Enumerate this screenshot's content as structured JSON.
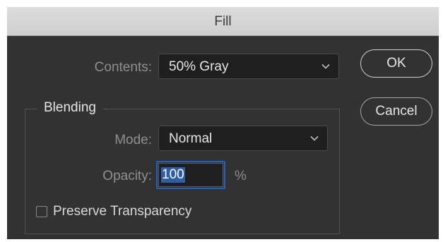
{
  "dialog": {
    "title": "Fill"
  },
  "contents": {
    "label": "Contents:",
    "value": "50% Gray",
    "chevron_icon": "chevron-down-icon"
  },
  "buttons": {
    "ok_label": "OK",
    "cancel_label": "Cancel"
  },
  "blending": {
    "group_label": "Blending",
    "mode_label": "Mode:",
    "mode_value": "Normal",
    "opacity_label": "Opacity:",
    "opacity_value": "100",
    "opacity_unit": "%",
    "preserve_transparency_label": "Preserve Transparency",
    "preserve_transparency_checked": false
  },
  "colors": {
    "dialog_background": "#323232",
    "titlebar_background": "#d6d6d6",
    "field_background": "#1f1f1f",
    "focus_accent": "#1e62c8",
    "selection_highlight": "#2f5ea8"
  }
}
